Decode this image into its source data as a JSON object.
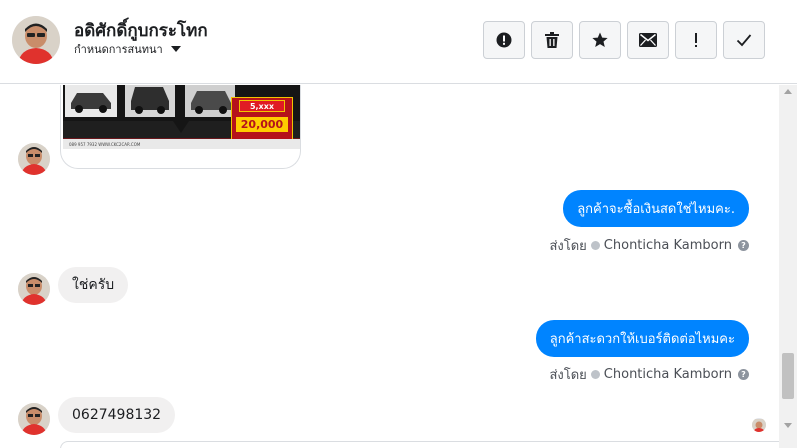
{
  "header": {
    "contact_name": "อดิศักดิ์กูบกระโทก",
    "assign_label": "กำหนดการสนทนา",
    "actions": [
      {
        "icon": "alert-circle-icon",
        "name": "mark-spam-button"
      },
      {
        "icon": "trash-icon",
        "name": "delete-button"
      },
      {
        "icon": "star-icon",
        "name": "star-button"
      },
      {
        "icon": "envelope-icon",
        "name": "mark-unread-button"
      },
      {
        "icon": "exclamation-icon",
        "name": "follow-up-button"
      },
      {
        "icon": "check-icon",
        "name": "mark-done-button"
      }
    ]
  },
  "thread": {
    "ad_card": {
      "price_small": "5,xxx",
      "price_big": "20,000",
      "phone_line": "089 957 7932 WWW.CKC2CAR.COM"
    },
    "messages": [
      {
        "direction": "out",
        "text": "ลูกค้าจะซื้อเงินสดใช่ไหมคะ."
      },
      {
        "direction": "in",
        "text": "ใช่ครับ"
      },
      {
        "direction": "out",
        "text": "ลูกค้าสะดวกให้เบอร์ติดต่อไหมคะ"
      },
      {
        "direction": "in",
        "text": "0627498132"
      }
    ],
    "sent_by_prefix": "ส่งโดย",
    "sent_by_name": "Chonticha Kamborn",
    "help_glyph": "?"
  },
  "colors": {
    "outgoing_bubble": "#0084ff",
    "incoming_bubble": "#f1f0f0",
    "ad_red": "#b5121b",
    "ad_yellow": "#ffcc00"
  }
}
